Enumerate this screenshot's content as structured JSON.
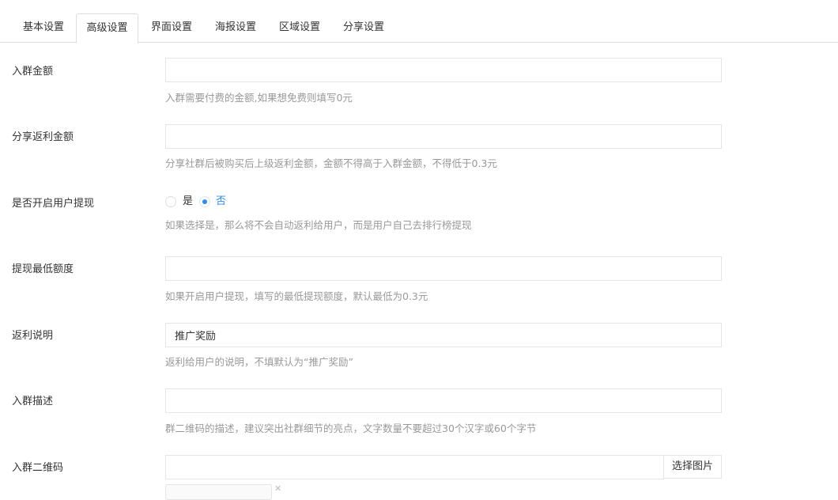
{
  "tabs": [
    {
      "label": "基本设置"
    },
    {
      "label": "高级设置"
    },
    {
      "label": "界面设置"
    },
    {
      "label": "海报设置"
    },
    {
      "label": "区域设置"
    },
    {
      "label": "分享设置"
    }
  ],
  "active_tab": "高级设置",
  "fields": {
    "join_amount": {
      "label": "入群金额",
      "value": "",
      "help": "入群需要付费的金额,如果想免费则填写0元"
    },
    "share_rebate": {
      "label": "分享返利金额",
      "value": "",
      "help": "分享社群后被购买后上级返利金额，金额不得高于入群金额，不得低于0.3元"
    },
    "enable_withdraw": {
      "label": "是否开启用户提现",
      "options": [
        "是",
        "否"
      ],
      "selected": "否",
      "help": "如果选择是，那么将不会自动返利给用户，而是用户自己去排行榜提现"
    },
    "min_withdraw": {
      "label": "提现最低额度",
      "value": "",
      "help": "如果开启用户提现，填写的最低提现额度，默认最低为0.3元"
    },
    "rebate_note": {
      "label": "返利说明",
      "value": "推广奖励",
      "help": "返利给用户的说明，不填默认为“推广奖励”"
    },
    "join_desc": {
      "label": "入群描述",
      "value": "",
      "help": "群二维码的描述，建议突出社群细节的亮点，文字数量不要超过30个汉字或60个字节"
    },
    "join_qrcode": {
      "label": "入群二维码",
      "value": "",
      "button_label": "选择图片"
    }
  },
  "icons": {
    "radio_checked_color": "#2d8cf0",
    "close": "close-icon"
  }
}
